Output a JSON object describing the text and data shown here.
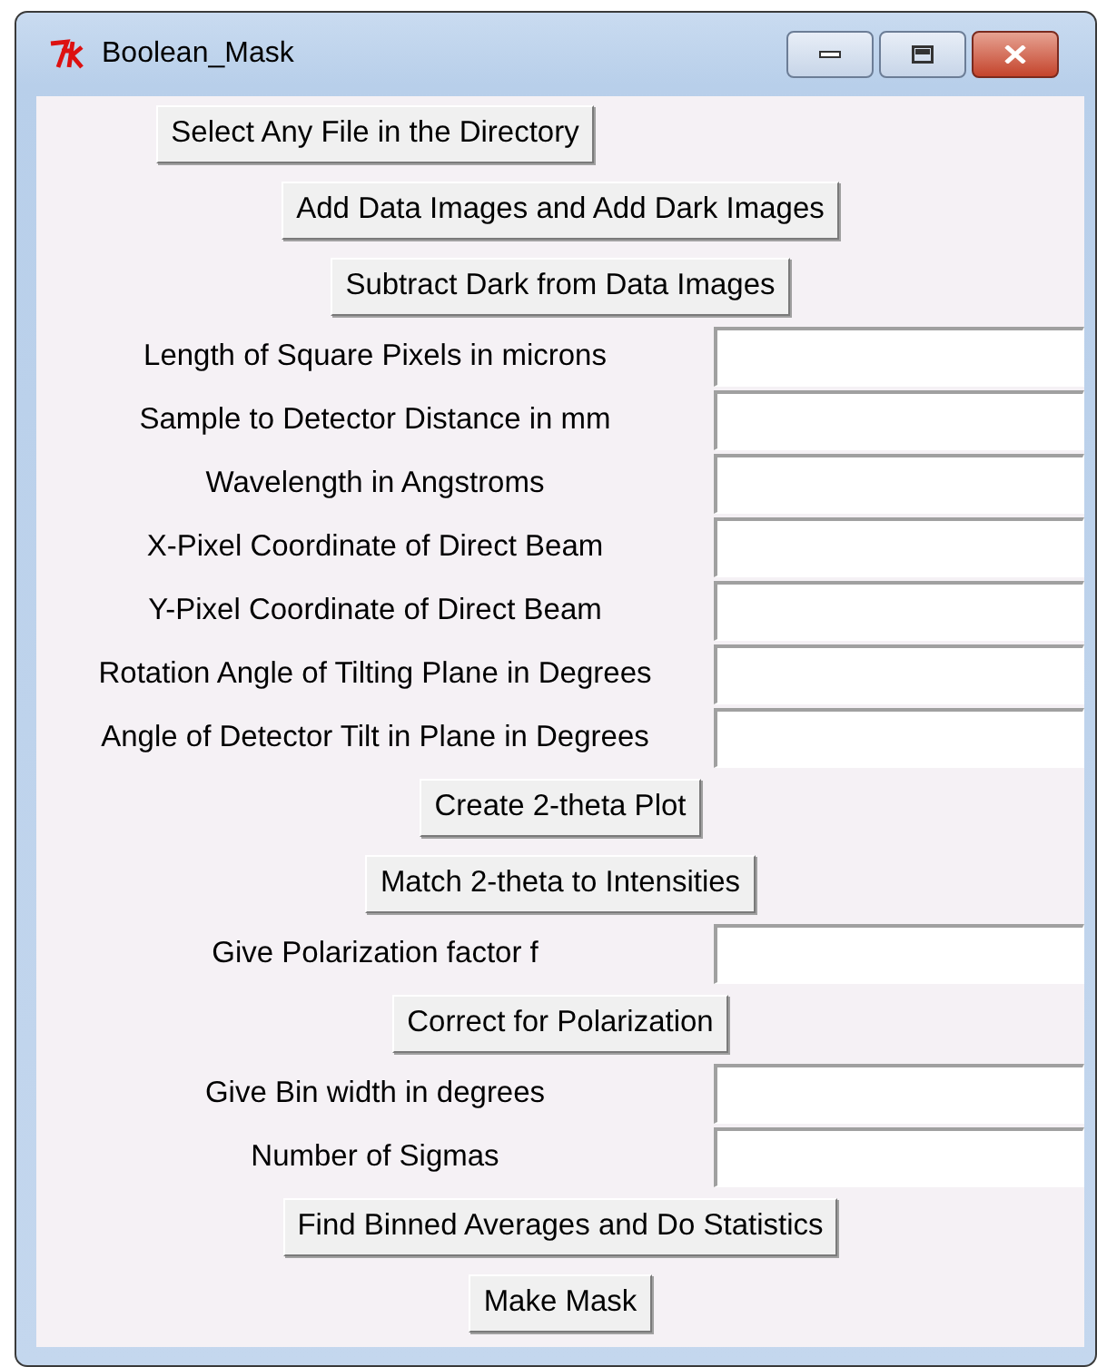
{
  "window": {
    "title": "Boolean_Mask"
  },
  "items": [
    {
      "kind": "narrow-button",
      "label": "Select Any File in the Directory"
    },
    {
      "kind": "wide-button",
      "label": "Add Data Images and Add Dark Images"
    },
    {
      "kind": "wide-button",
      "label": "Subtract Dark from Data Images"
    },
    {
      "kind": "field",
      "label": "Length of Square Pixels in microns"
    },
    {
      "kind": "field",
      "label": "Sample to Detector Distance in mm"
    },
    {
      "kind": "field",
      "label": "Wavelength in Angstroms"
    },
    {
      "kind": "field",
      "label": "X-Pixel Coordinate of Direct Beam"
    },
    {
      "kind": "field",
      "label": "Y-Pixel Coordinate of Direct Beam"
    },
    {
      "kind": "field",
      "label": "Rotation Angle of Tilting Plane in Degrees"
    },
    {
      "kind": "field",
      "label": "Angle of Detector Tilt in Plane in Degrees"
    },
    {
      "kind": "wide-button",
      "label": "Create 2-theta Plot"
    },
    {
      "kind": "wide-button",
      "label": "Match 2-theta to Intensities"
    },
    {
      "kind": "field",
      "label": "Give Polarization factor f"
    },
    {
      "kind": "wide-button",
      "label": "Correct for Polarization"
    },
    {
      "kind": "field",
      "label": "Give Bin width in degrees"
    },
    {
      "kind": "field",
      "label": "Number of Sigmas"
    },
    {
      "kind": "wide-button",
      "label": "Find Binned Averages and Do Statistics"
    },
    {
      "kind": "wide-button",
      "label": "Make Mask"
    }
  ]
}
